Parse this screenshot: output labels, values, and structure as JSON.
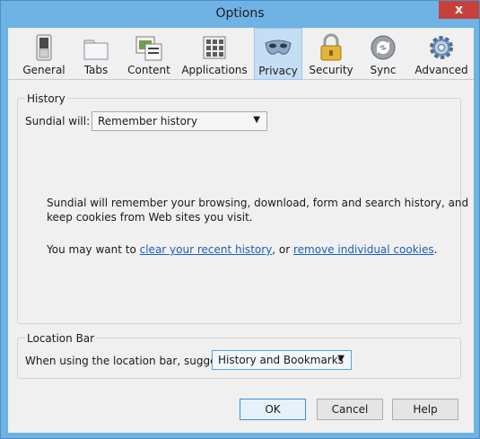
{
  "window": {
    "title": "Options",
    "close_glyph": "x"
  },
  "toolbar": {
    "items": [
      {
        "label": "General",
        "icon": "switch-icon"
      },
      {
        "label": "Tabs",
        "icon": "tabs-icon"
      },
      {
        "label": "Content",
        "icon": "content-icon"
      },
      {
        "label": "Applications",
        "icon": "applications-icon"
      },
      {
        "label": "Privacy",
        "icon": "mask-icon",
        "selected": true
      },
      {
        "label": "Security",
        "icon": "padlock-icon"
      },
      {
        "label": "Sync",
        "icon": "sync-icon"
      },
      {
        "label": "Advanced",
        "icon": "gear-icon"
      }
    ]
  },
  "history": {
    "group_title": "History",
    "will_label": "Sundial will:",
    "select_value": "Remember history",
    "desc_line1": "Sundial will remember your browsing, download, form and search history, and",
    "desc_line2": "keep cookies from Web sites you visit.",
    "may_prefix": "You may want to ",
    "link_clear": "clear your recent history",
    "may_middle": ", or ",
    "link_remove": "remove individual cookies",
    "may_suffix": "."
  },
  "location_bar": {
    "group_title": "Location Bar",
    "suggest_label": "When using the location bar, suggest:",
    "select_value": "History and Bookmarks"
  },
  "buttons": {
    "ok": "OK",
    "cancel": "Cancel",
    "help": "Help"
  },
  "colors": {
    "titlebar": "#6fb3e4",
    "selected_tab": "#c6def4",
    "link": "#1b5fb4",
    "close": "#c7413a"
  }
}
